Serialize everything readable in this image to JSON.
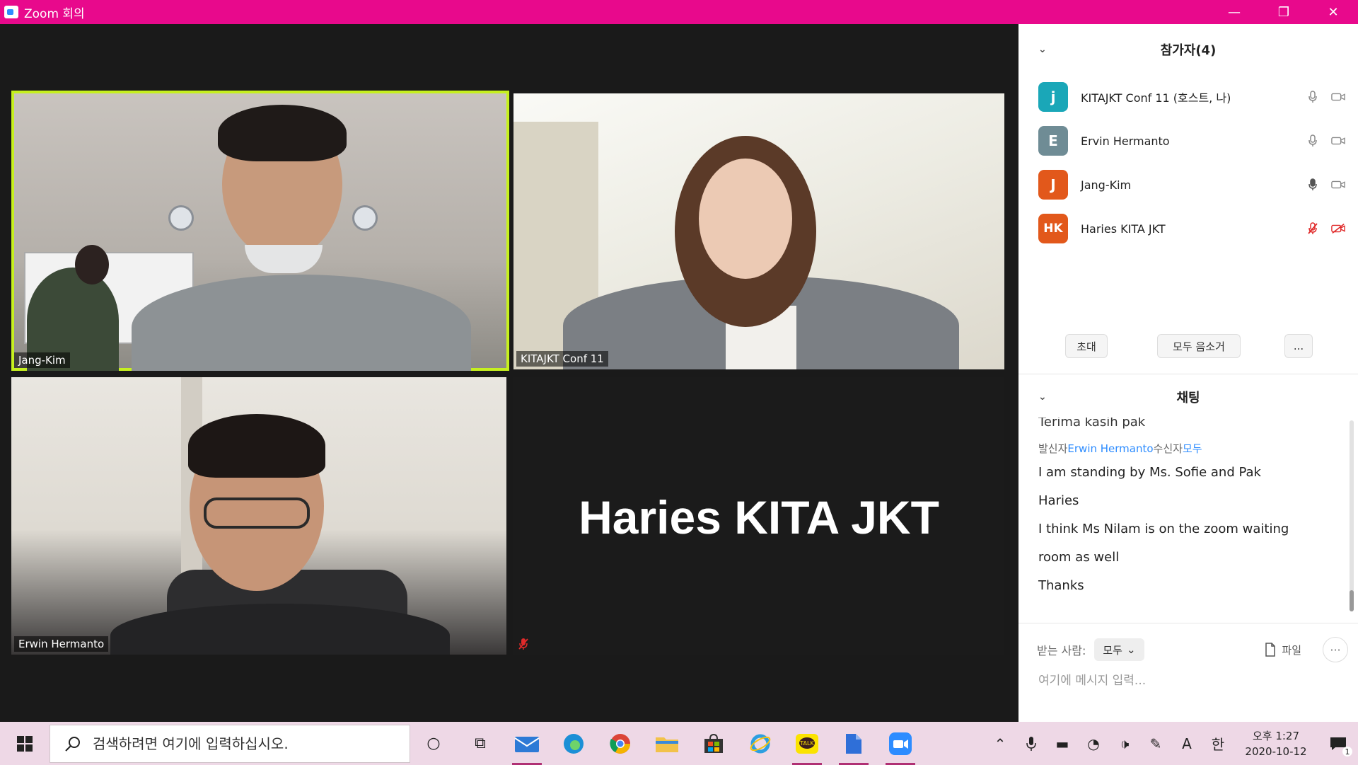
{
  "window": {
    "title": "Zoom 회의",
    "minimize": "—",
    "restore": "❐",
    "close": "✕"
  },
  "video_tiles": [
    {
      "name": "Jang-Kim",
      "active_speaker": true
    },
    {
      "name": "KITAJKT Conf 11",
      "active_speaker": false
    },
    {
      "name": "Erwin Hermanto",
      "active_speaker": false
    },
    {
      "name": "Haries KITA JKT",
      "display_name_large": "Haries KITA JKT",
      "muted": true
    }
  ],
  "participants_panel": {
    "title": "참가자(4)",
    "participants": [
      {
        "initial": "j",
        "name": "KITAJKT Conf 11 (호스트, 나)",
        "avatar_color": "#1aa7b8",
        "mic": "unmuted",
        "video": "on"
      },
      {
        "initial": "E",
        "name": "Ervin Hermanto",
        "avatar_color": "#6f8c95",
        "mic": "unmuted",
        "video": "on"
      },
      {
        "initial": "J",
        "name": "Jang-Kim",
        "avatar_color": "#e2581b",
        "mic": "unmuted",
        "video": "on"
      },
      {
        "initial": "HK",
        "name": "Haries KITA JKT",
        "avatar_color": "#e2581b",
        "mic": "muted",
        "video": "off"
      }
    ],
    "buttons": {
      "invite": "초대",
      "mute_all": "모두 음소거",
      "more": "..."
    }
  },
  "chat_panel": {
    "title": "채팅",
    "cut_line": "Terima kasih pak",
    "meta_prefix": "발신자",
    "meta_sender": "Erwin Hermanto",
    "meta_mid": "수신자",
    "meta_recipient": "모두",
    "messages": [
      "I am standing by Ms. Sofie and Pak",
      "Haries",
      "I think Ms Nilam is on the zoom waiting",
      "room as well",
      "Thanks"
    ],
    "to_label": "받는 사람:",
    "to_value": "모두",
    "file_label": "파일",
    "input_placeholder": "여기에 메시지 입력..."
  },
  "taskbar": {
    "search_placeholder": "검색하려면 여기에 입력하십시오.",
    "clock_top": "오후 1:27",
    "clock_bottom": "2020-10-12",
    "ime": "한",
    "font_a": "A",
    "notification_count": "1"
  },
  "colors": {
    "titlebar": "#e8098c",
    "active_speaker_border": "#c6f01f",
    "muted_red": "#e02a2a",
    "link_blue": "#2d8cff"
  }
}
